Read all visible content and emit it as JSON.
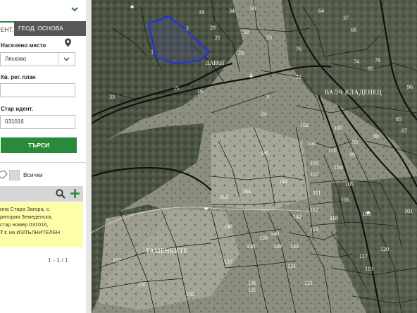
{
  "tabs": {
    "active_label": "ЕНТ.",
    "other_label": "ГЕОД. ОСНОВА"
  },
  "form": {
    "settlement_label": "Населено място",
    "settlement_value": "Лясково",
    "reg_plan_label": "Кв. рег. план",
    "reg_plan_value": "",
    "old_ident_label": "Стар идент.",
    "old_ident_value": "031016",
    "search_button": "ТЪРСИ"
  },
  "filter": {
    "all_label": "Всички"
  },
  "result": {
    "lines": [
      "ина Стара Загора, с.",
      "ритория Земеделска,",
      "стар номер 031016,",
      "на ИЗПЪЛНИТЕЛЕН"
    ],
    "line4_prefix": "7 г."
  },
  "pager": {
    "text": "1 - 1 / 1"
  },
  "map": {
    "place_names": [
      "ТАМЕНКИТЕ",
      "ВАЛЧ.КЛАДЕНЕЦ",
      "ДАРАН"
    ],
    "parcel_numbers": [
      "56",
      "34",
      "64",
      "37",
      "68",
      "53",
      "50",
      "29",
      "21",
      "20",
      "33",
      "1",
      "15",
      "16",
      "19",
      "2",
      "76",
      "71",
      "74",
      "78",
      "80",
      "3",
      "96",
      "24",
      "87",
      "88",
      "85",
      "102",
      "108",
      "100",
      "93",
      "89",
      "145",
      "144",
      "110",
      "109",
      "107",
      "104",
      "105",
      "164",
      "163",
      "111",
      "112",
      "106",
      "103",
      "101",
      "148",
      "140",
      "142",
      "139",
      "137",
      "138",
      "157",
      "156",
      "150",
      "117",
      "119",
      "120",
      "121",
      "149",
      "143",
      "113",
      "118",
      "136",
      "135",
      "131"
    ],
    "selected_color": "#2233dd"
  },
  "colors": {
    "accent": "#2a8a3b",
    "tab_bg": "#575757",
    "result_bg": "#fffea8"
  }
}
